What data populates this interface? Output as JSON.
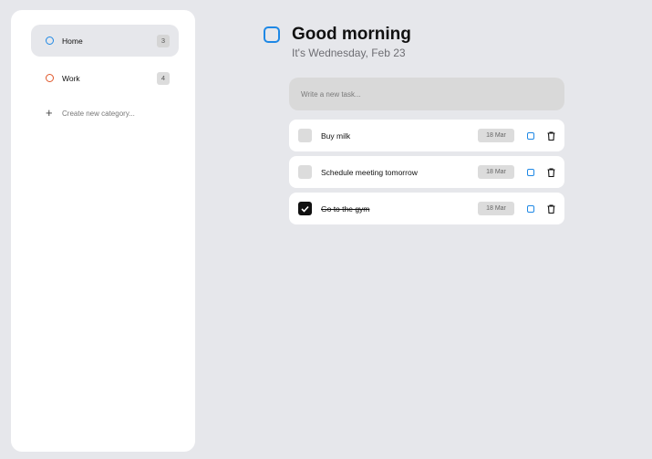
{
  "sidebar": {
    "categories": [
      {
        "label": "Home",
        "count": "3",
        "color": "#1e88e5",
        "icon": "circle-outline-icon"
      },
      {
        "label": "Work",
        "count": "4",
        "color": "#e0572a",
        "icon": "circle-outline-icon"
      }
    ],
    "create_label": "Create new category...",
    "create_icon": "plus-icon"
  },
  "header": {
    "title": "Good morning",
    "subtitle": "It's Wednesday, Feb 23",
    "icon": "square-outline-icon",
    "accent": "#1e88e5"
  },
  "new_task": {
    "placeholder": "Write a new task..."
  },
  "tasks": [
    {
      "title": "Buy milk",
      "date": "18 Mar",
      "done": false,
      "category_color": "#1e88e5"
    },
    {
      "title": "Schedule meeting tomorrow",
      "date": "18 Mar",
      "done": false,
      "category_color": "#1e88e5"
    },
    {
      "title": "Go to the gym",
      "date": "18 Mar",
      "done": true,
      "category_color": "#1e88e5"
    }
  ]
}
